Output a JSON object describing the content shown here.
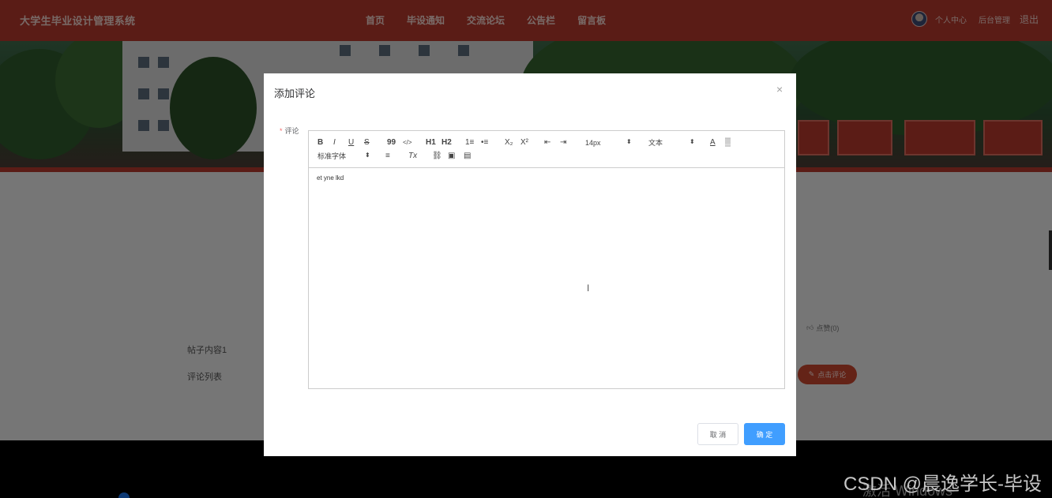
{
  "header": {
    "brand": "大学生毕业设计管理系统",
    "nav": [
      "首页",
      "毕设通知",
      "交流论坛",
      "公告栏",
      "留言板"
    ],
    "user_center": "个人中心",
    "admin": "后台管理",
    "logout": "退出"
  },
  "page": {
    "post_content": "帖子内容1",
    "comment_list_label": "评论列表",
    "like_label": "点赞(0)",
    "comment_button": "点击评论"
  },
  "modal": {
    "title": "添加评论",
    "close": "×",
    "required_mark": "*",
    "field_label": "评论",
    "toolbar": {
      "bold": "B",
      "italic": "I",
      "underline": "U",
      "strike": "S",
      "quote": "99",
      "code": "</>",
      "h1": "H1",
      "h2": "H2",
      "ordered_list": "1≡",
      "bullet_list": "•≡",
      "subscript": "X₂",
      "superscript": "X²",
      "outdent": "⇤",
      "indent": "⇥",
      "font_size": "14px",
      "text_type": "文本",
      "color": "A",
      "background": "▒",
      "font_family": "标准字体",
      "align": "≡",
      "clean": "Tx",
      "link": "⛓",
      "image": "▣",
      "video": "▤"
    },
    "content": "et yne lkd",
    "cancel": "取 消",
    "confirm": "确 定"
  },
  "watermark": "CSDN @晨逸学长-毕设",
  "windows_watermark": "激活 Windows"
}
